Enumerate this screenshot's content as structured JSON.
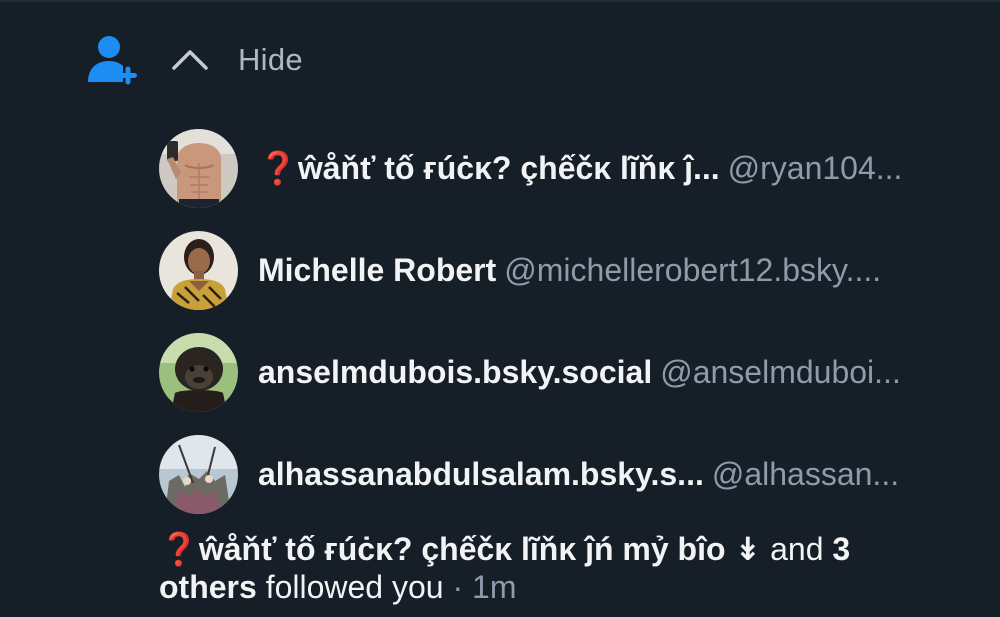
{
  "header": {
    "toggle_label": "Hide"
  },
  "followers": [
    {
      "display_name": "❓ŵåňť tố ғúċκ? çhếčκ lĩňκ ĵ...",
      "handle": "@ryan104...",
      "avatar": "shirtless-man-avatar"
    },
    {
      "display_name": "Michelle Robert",
      "handle": "@michellerobert12.bsky....",
      "avatar": "woman-avatar"
    },
    {
      "display_name": "anselmdubois.bsky.social",
      "handle": "@anselmduboi...",
      "avatar": "chimpanzee-avatar"
    },
    {
      "display_name": "alhassanabdulsalam.bsky.s...",
      "handle": "@alhassan...",
      "avatar": "outdoor-scene-avatar"
    }
  ],
  "summary": {
    "actor_name": "❓ŵåňť tố ғúċκ? çhếčκ lĩňκ ĵń mỷ bîo ↡",
    "and_text": " and ",
    "others_count": "3",
    "others_word": "others",
    "action_text": " followed you",
    "separator": " · ",
    "time": "1m"
  },
  "colors": {
    "background": "#161e27",
    "accent": "#1d8cf3",
    "primary_text": "#f1f3f5",
    "muted_text": "#8d9bab"
  }
}
